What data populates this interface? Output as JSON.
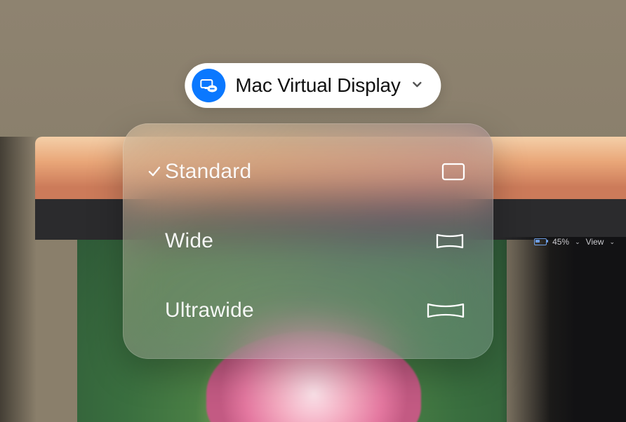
{
  "header": {
    "title": "Mac Virtual Display"
  },
  "options": {
    "standard": {
      "label": "Standard",
      "selected": true
    },
    "wide": {
      "label": "Wide",
      "selected": false
    },
    "ultrawide": {
      "label": "Ultrawide",
      "selected": false
    }
  },
  "status": {
    "battery": "45%",
    "view_label": "View"
  }
}
